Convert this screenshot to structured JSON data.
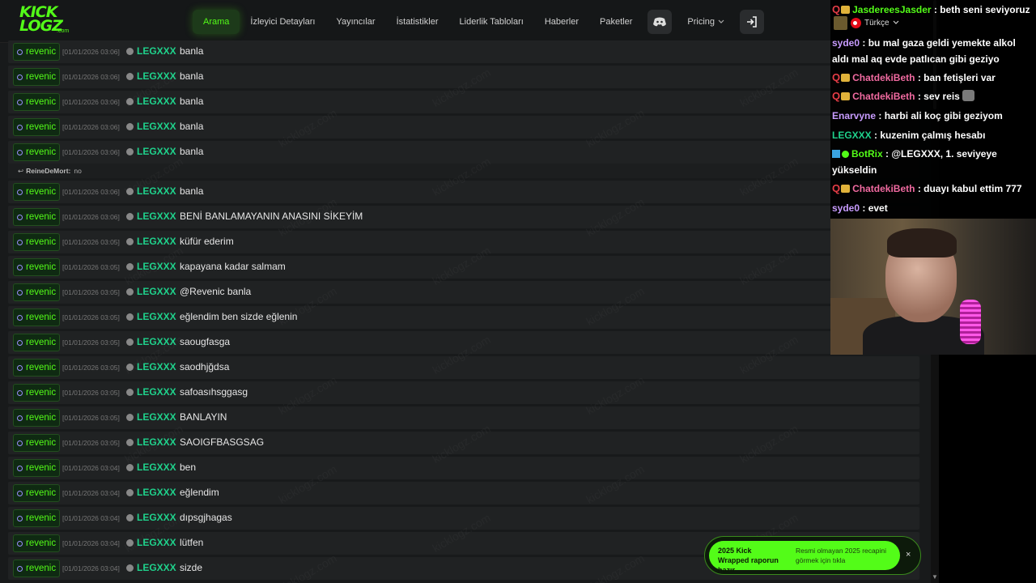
{
  "navbar": {
    "logo_top": "KICK",
    "logo_bottom": "LOGZ",
    "logo_suffix": ".com",
    "items": [
      "Arama",
      "İzleyici Detayları",
      "Yayıncılar",
      "İstatistikler",
      "Liderlik Tabloları",
      "Haberler",
      "Paketler"
    ],
    "pricing_label": "Pricing"
  },
  "badge_label": "revenic",
  "reply": {
    "author": "ReineDeMort:",
    "text": "no"
  },
  "rows": [
    {
      "ts": "[01/01/2026 03:06]",
      "user": "LEGXXX",
      "msg": "banla"
    },
    {
      "ts": "[01/01/2026 03:06]",
      "user": "LEGXXX",
      "msg": "banla"
    },
    {
      "ts": "[01/01/2026 03:06]",
      "user": "LEGXXX",
      "msg": "banla"
    },
    {
      "ts": "[01/01/2026 03:06]",
      "user": "LEGXXX",
      "msg": "banla"
    },
    {
      "ts": "[01/01/2026 03:06]",
      "user": "LEGXXX",
      "msg": "banla"
    },
    {
      "ts": "[01/01/2026 03:06]",
      "user": "LEGXXX",
      "msg": "banla"
    },
    {
      "ts": "[01/01/2026 03:06]",
      "user": "LEGXXX",
      "msg": "BENİ BANLAMAYANIN ANASINI SİKEYİM"
    },
    {
      "ts": "[01/01/2026 03:05]",
      "user": "LEGXXX",
      "msg": "küfür ederim"
    },
    {
      "ts": "[01/01/2026 03:05]",
      "user": "LEGXXX",
      "msg": "kapayana kadar salmam"
    },
    {
      "ts": "[01/01/2026 03:05]",
      "user": "LEGXXX",
      "msg": "@Revenic banla"
    },
    {
      "ts": "[01/01/2026 03:05]",
      "user": "LEGXXX",
      "msg": "eğlendim ben sizde eğlenin"
    },
    {
      "ts": "[01/01/2026 03:05]",
      "user": "LEGXXX",
      "msg": "saougfasga"
    },
    {
      "ts": "[01/01/2026 03:05]",
      "user": "LEGXXX",
      "msg": "saodhjğdsa"
    },
    {
      "ts": "[01/01/2026 03:05]",
      "user": "LEGXXX",
      "msg": "safoasıhsggasg"
    },
    {
      "ts": "[01/01/2026 03:05]",
      "user": "LEGXXX",
      "msg": "BANLAYIN"
    },
    {
      "ts": "[01/01/2026 03:05]",
      "user": "LEGXXX",
      "msg": "SAOIGFBASGSAG"
    },
    {
      "ts": "[01/01/2026 03:04]",
      "user": "LEGXXX",
      "msg": "ben"
    },
    {
      "ts": "[01/01/2026 03:04]",
      "user": "LEGXXX",
      "msg": "eğlendim"
    },
    {
      "ts": "[01/01/2026 03:04]",
      "user": "LEGXXX",
      "msg": "dıpsgjhagas"
    },
    {
      "ts": "[01/01/2026 03:04]",
      "user": "LEGXXX",
      "msg": "lütfen"
    },
    {
      "ts": "[01/01/2026 03:04]",
      "user": "LEGXXX",
      "msg": "sizde"
    }
  ],
  "watermark_text": "kicklogz.com",
  "overlay": {
    "lang_label": "Türkçe",
    "lines": [
      {
        "user": "JasdereesJasder",
        "color": "#53fc18",
        "text": ": beth seni seviyoruz",
        "prefix": "q"
      },
      {
        "user": "syde0",
        "color": "#c89cff",
        "text": ": bu mal gaza geldi yemekte alkol",
        "prefix": ""
      },
      {
        "user": "",
        "color": "#fff",
        "text": "aldı mal aq evde patlıcan gibi geziyo",
        "prefix": ""
      },
      {
        "user": "ChatdekiBeth",
        "color": "#f06aa0",
        "text": ": ban fetişleri var",
        "prefix": "q"
      },
      {
        "user": "ChatdekiBeth",
        "color": "#f06aa0",
        "text": ": sev reis",
        "prefix": "q"
      },
      {
        "user": "Enarvyne",
        "color": "#c89cff",
        "text": ": harbi ali koç gibi geziyom",
        "prefix": ""
      },
      {
        "user": "LEGXXX",
        "color": "#1fd18b",
        "text": ": kuzenim çalmış hesabı",
        "prefix": ""
      },
      {
        "user": "BotRix",
        "color": "#53fc18",
        "text": ": @LEGXXX, 1. seviyeye",
        "prefix": "bot"
      },
      {
        "user": "",
        "color": "#fff",
        "text": "yükseldin",
        "prefix": ""
      },
      {
        "user": "ChatdekiBeth",
        "color": "#f06aa0",
        "text": ": duayı kabul ettim 777",
        "prefix": "q"
      },
      {
        "user": "syde0",
        "color": "#c89cff",
        "text": ": evet",
        "prefix": ""
      }
    ]
  },
  "toast": {
    "title": "2025 Kick Wrapped raporun hazır",
    "body": "Resmi olmayan 2025 recapini görmek için tıkla",
    "close": "×"
  }
}
